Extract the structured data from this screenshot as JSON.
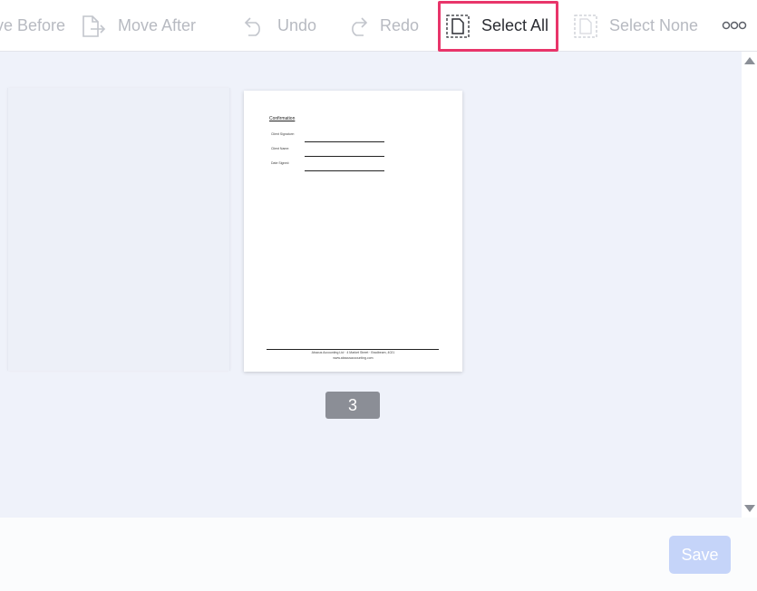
{
  "toolbar": {
    "move_before_label": "Move Before",
    "move_after_label": "Move After",
    "undo_label": "Undo",
    "redo_label": "Redo",
    "select_all_label": "Select All",
    "select_none_label": "Select None",
    "more_label": "ooo"
  },
  "document": {
    "title": "Confirmation",
    "fields": [
      "Client Signature:",
      "Client Name:",
      "Date Signed:"
    ],
    "footer_line1": "Abacus Accounting Ltd · 4 Market Street · Bradbeam, 4021",
    "footer_line2": "www.abacusaccounting.com"
  },
  "page_number": "3",
  "footer": {
    "save_label": "Save"
  },
  "colors": {
    "highlight": "#e8356a",
    "canvas_bg": "#eff2fa",
    "save_disabled": "#c5d4f9",
    "page_badge": "#8b8e96"
  }
}
